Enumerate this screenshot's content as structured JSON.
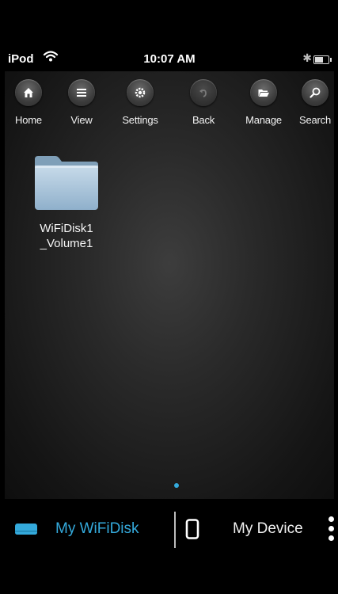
{
  "status_bar": {
    "carrier": "iPod",
    "time": "10:07 AM",
    "wifi_icon": "wifi-icon",
    "bluetooth_icon": "bluetooth-icon",
    "battery_icon": "battery-icon"
  },
  "toolbar": {
    "items": [
      {
        "label": "Home",
        "icon": "home-icon"
      },
      {
        "label": "View",
        "icon": "list-icon"
      },
      {
        "label": "Settings",
        "icon": "gear-icon"
      },
      {
        "label": "Back",
        "icon": "back-icon"
      },
      {
        "label": "Manage",
        "icon": "folder-open-icon"
      },
      {
        "label": "Search",
        "icon": "search-icon"
      }
    ]
  },
  "files": [
    {
      "name_line1": "WiFiDisk1",
      "name_line2": "_Volume1",
      "icon": "folder-icon"
    }
  ],
  "tabbar": {
    "wifidisk_label": "My WiFiDisk",
    "device_label": "My Device",
    "active": "My WiFiDisk"
  },
  "colors": {
    "accent": "#34aadc",
    "background": "#000000",
    "folder": "#a9c6dd"
  }
}
